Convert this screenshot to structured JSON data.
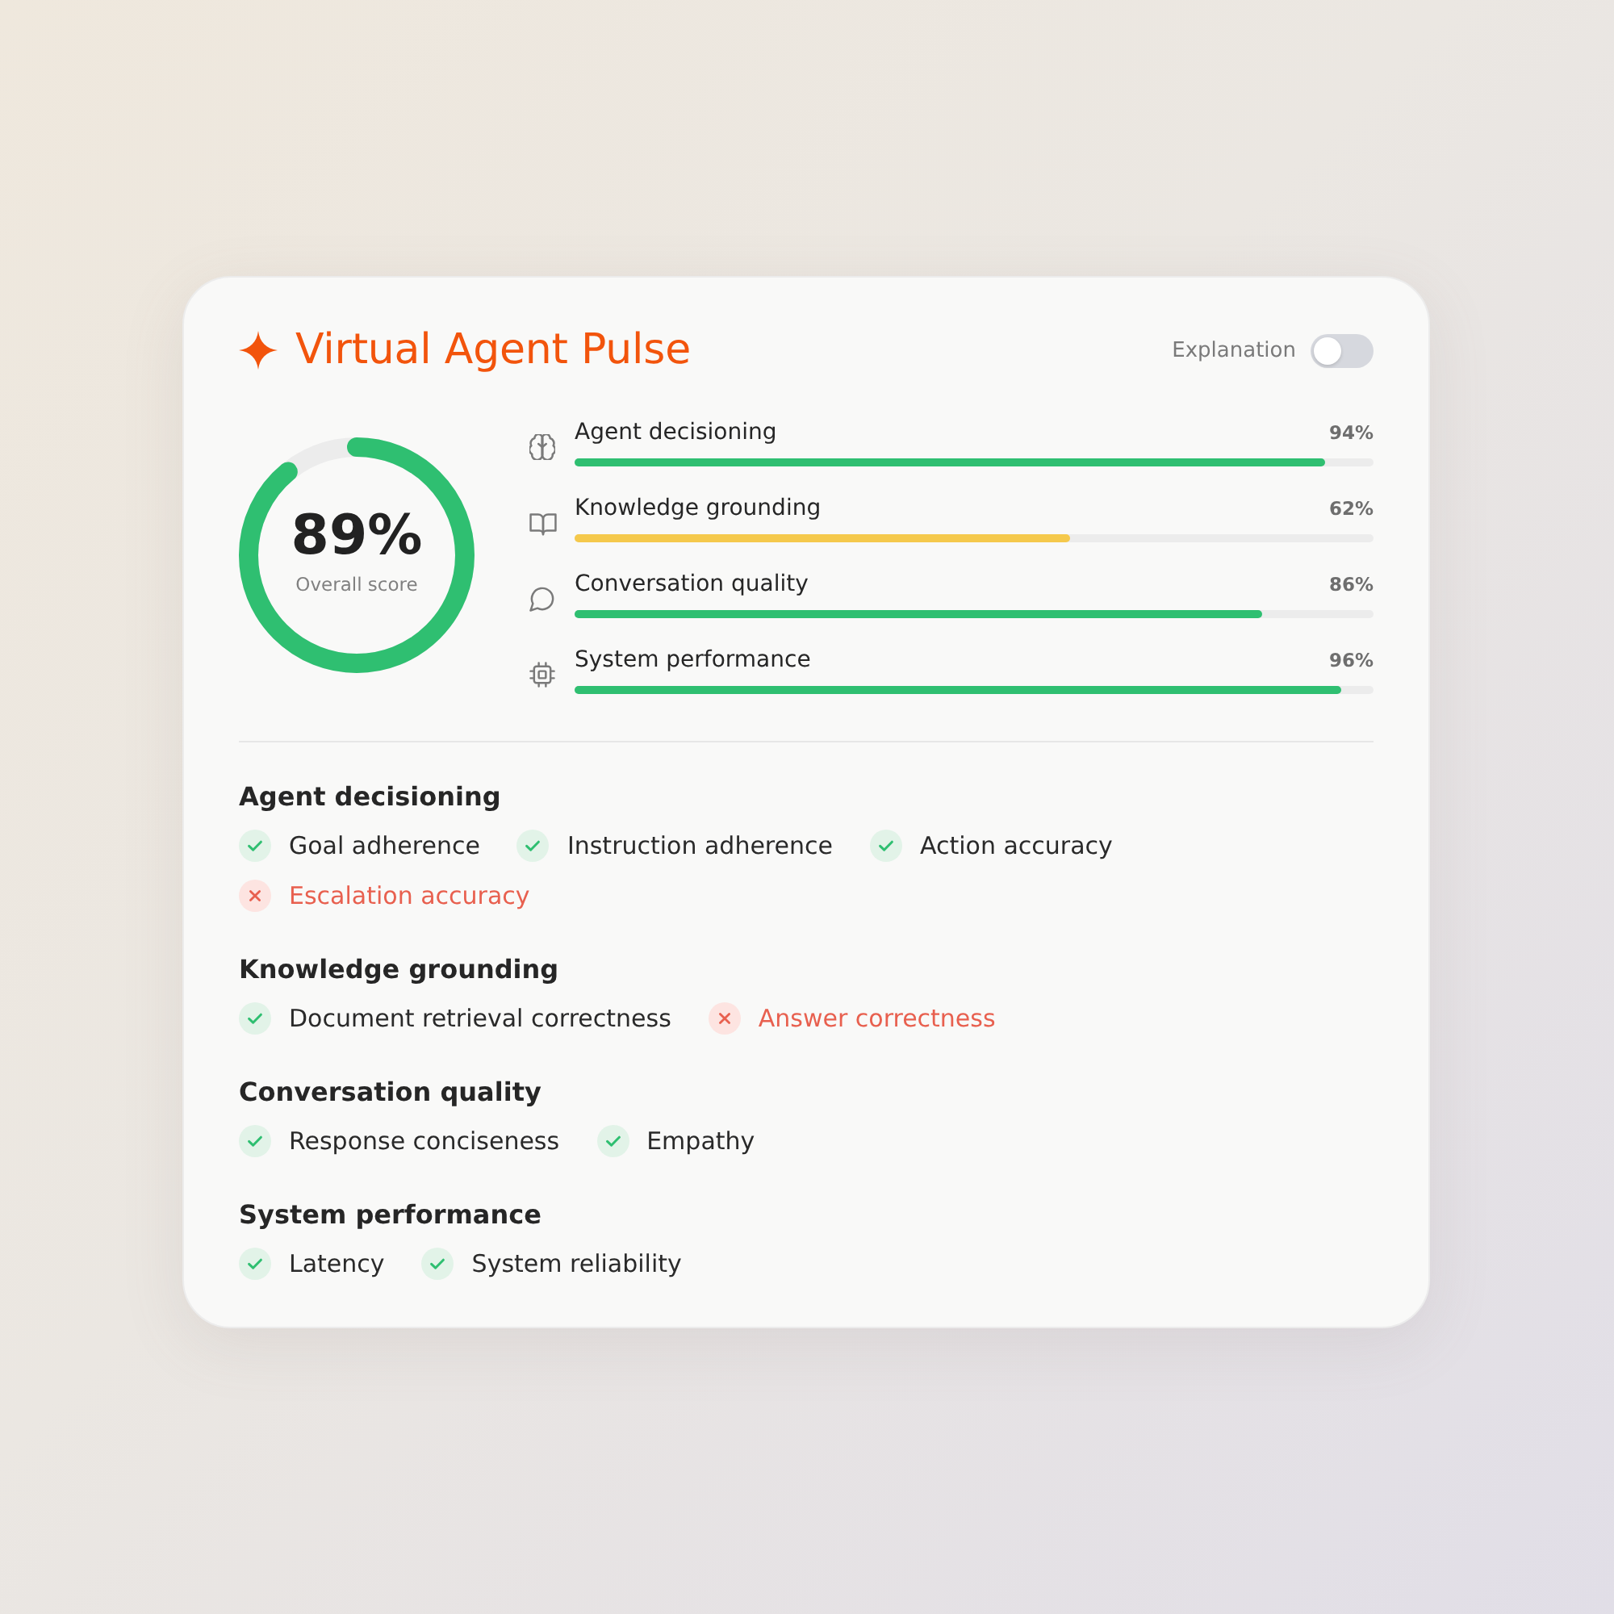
{
  "header": {
    "title": "Virtual Agent Pulse",
    "toggle": {
      "label": "Explanation",
      "on": false
    }
  },
  "overall": {
    "value": "89%",
    "label": "Overall score",
    "level": 0.89
  },
  "metrics": [
    {
      "name": "Agent decisioning",
      "reading": "94%",
      "level": 0.94,
      "color": "#2fbf71"
    },
    {
      "name": "Knowledge grounding",
      "reading": "62%",
      "level": 0.62,
      "color": "#f5c94c"
    },
    {
      "name": "Conversation quality",
      "reading": "86%",
      "level": 0.86,
      "color": "#2fbf71"
    },
    {
      "name": "System performance",
      "reading": "96%",
      "level": 0.96,
      "color": "#2fbf71"
    }
  ],
  "sections": [
    {
      "title": "Agent decisioning",
      "checks": [
        {
          "label": "Goal adherence",
          "passed": true
        },
        {
          "label": "Instruction adherence",
          "passed": true
        },
        {
          "label": "Action accuracy",
          "passed": true
        },
        {
          "label": "Escalation accuracy",
          "passed": false
        }
      ]
    },
    {
      "title": "Knowledge grounding",
      "checks": [
        {
          "label": "Document retrieval correctness",
          "passed": true
        },
        {
          "label": "Answer correctness",
          "passed": false
        }
      ]
    },
    {
      "title": "Conversation quality",
      "checks": [
        {
          "label": "Response conciseness",
          "passed": true
        },
        {
          "label": "Empathy",
          "passed": true
        }
      ]
    },
    {
      "title": "System performance",
      "checks": [
        {
          "label": "Latency",
          "passed": true
        },
        {
          "label": "System reliability",
          "passed": true
        }
      ]
    }
  ]
}
